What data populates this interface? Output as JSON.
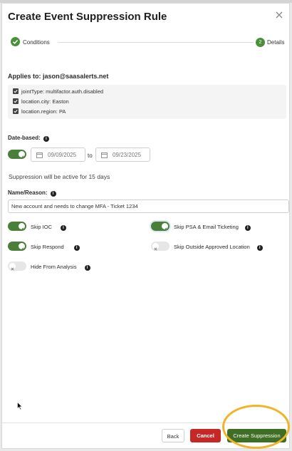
{
  "dialog": {
    "title": "Create Event Suppression Rule"
  },
  "steps": [
    {
      "label": "Conditions",
      "status": "done"
    },
    {
      "label": "Details",
      "number": "2",
      "status": "current"
    }
  ],
  "applies_to": {
    "label": "Applies to:",
    "email": "jason@saasalerts.net",
    "conditions": [
      "jointType: multifactor.auth.disabled",
      "location.city: Easton",
      "location.region: PA"
    ]
  },
  "date_based": {
    "label": "Date-based:",
    "info_icon": "i",
    "enabled": true,
    "start_date": "09/09/2025",
    "to_label": "to",
    "end_date": "09/23/2025",
    "active_text": "Suppression will be active for 15 days"
  },
  "reason": {
    "label": "Name/Reason:",
    "info_icon": "i",
    "value": "New account and needs to change MFA - Ticket 1234"
  },
  "options": [
    {
      "label": "Skip IOC",
      "enabled": true
    },
    {
      "label": "Skip PSA & Email Ticketing",
      "enabled": true
    },
    {
      "label": "Skip Respond",
      "enabled": true
    },
    {
      "label": "Skip Outside Approved Location",
      "enabled": false
    },
    {
      "label": "Hide From Analysis",
      "enabled": false
    }
  ],
  "footer": {
    "back_label": "Back",
    "cancel_label": "Cancel",
    "create_label": "Create Suppression"
  },
  "colors": {
    "accent_green": "#4a7f3a",
    "cancel_red": "#c62828",
    "highlight": "#f0b429"
  }
}
